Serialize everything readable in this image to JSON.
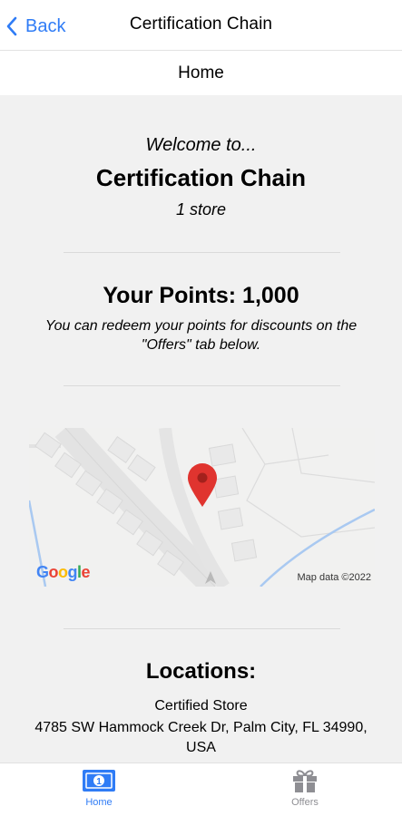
{
  "navbar": {
    "back_label": "Back",
    "title": "Certification Chain"
  },
  "subheader": {
    "title": "Home"
  },
  "welcome": {
    "greeting": "Welcome to...",
    "store_name": "Certification Chain",
    "store_count": "1 store"
  },
  "points": {
    "title": "Your Points: 1,000",
    "description": "You can redeem your points for discounts on the \"Offers\" tab below."
  },
  "map": {
    "provider_logo": "Google",
    "attribution": "Map data ©2022",
    "pin_color": "#e0342f"
  },
  "locations": {
    "title": "Locations:",
    "name": "Certified Store",
    "address": "4785 SW Hammock Creek Dr, Palm City, FL 34990, USA"
  },
  "tabbar": {
    "tabs": [
      {
        "label": "Home",
        "icon": "banknote-icon",
        "active": true
      },
      {
        "label": "Offers",
        "icon": "gift-icon",
        "active": false
      }
    ]
  },
  "colors": {
    "accent": "#2f7cf6",
    "inactive": "#8e8e93",
    "content_bg": "#f1f1f1"
  }
}
